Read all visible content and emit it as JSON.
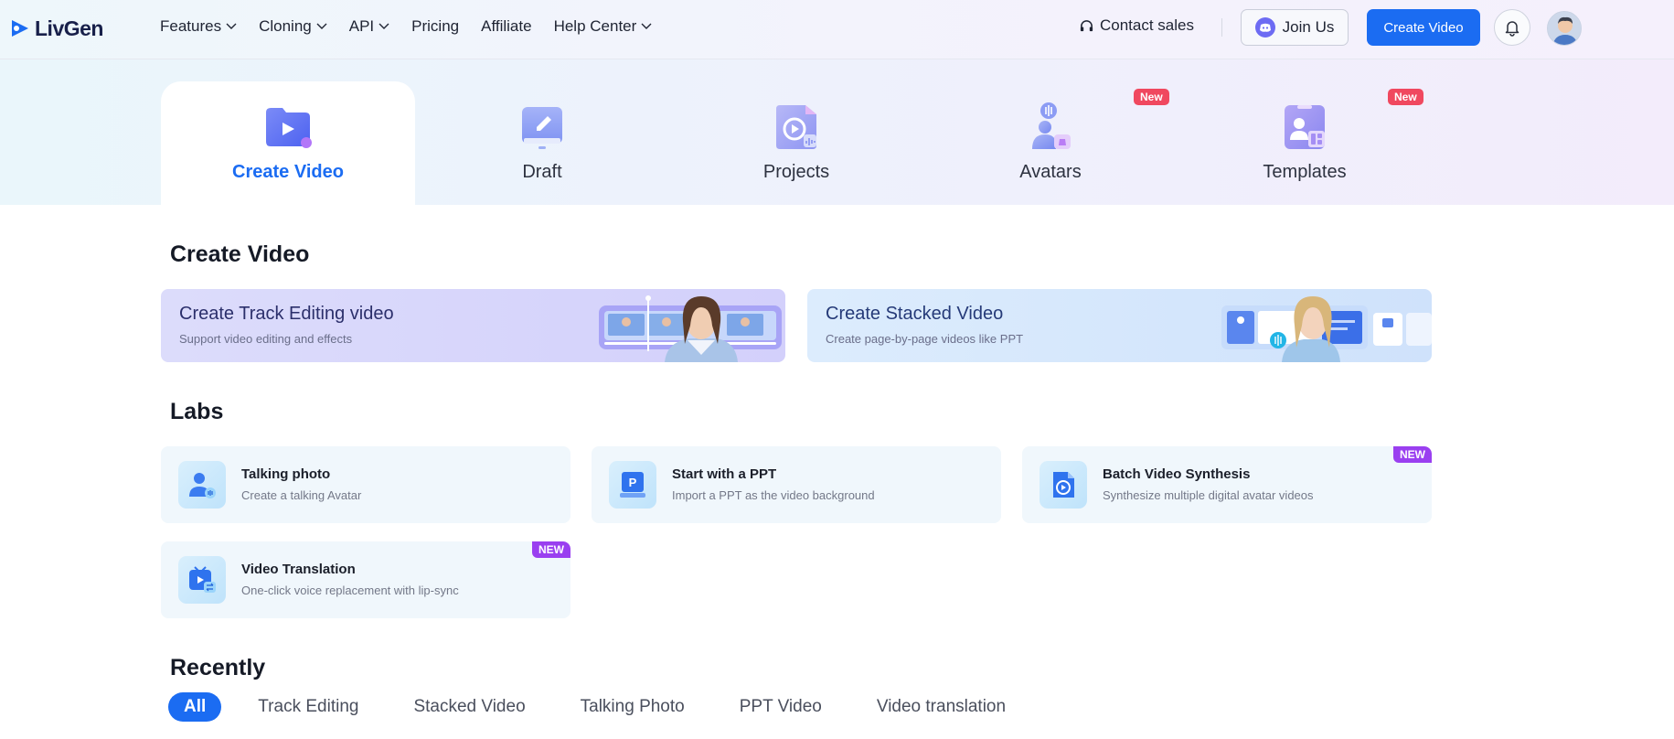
{
  "brand": {
    "name": "LivGen"
  },
  "nav": {
    "items": [
      {
        "label": "Features",
        "dropdown": true
      },
      {
        "label": "Cloning",
        "dropdown": true
      },
      {
        "label": "API",
        "dropdown": true
      },
      {
        "label": "Pricing",
        "dropdown": false
      },
      {
        "label": "Affiliate",
        "dropdown": false
      },
      {
        "label": "Help Center",
        "dropdown": true
      }
    ],
    "contact_label": "Contact sales",
    "join_label": "Join Us",
    "create_label": "Create Video"
  },
  "tabs": [
    {
      "label": "Create Video",
      "active": true,
      "badge": ""
    },
    {
      "label": "Draft",
      "active": false,
      "badge": ""
    },
    {
      "label": "Projects",
      "active": false,
      "badge": ""
    },
    {
      "label": "Avatars",
      "active": false,
      "badge": "New"
    },
    {
      "label": "Templates",
      "active": false,
      "badge": "New"
    }
  ],
  "create_section": {
    "title": "Create Video",
    "cards": [
      {
        "title": "Create Track Editing video",
        "subtitle": "Support video editing and effects"
      },
      {
        "title": "Create Stacked Video",
        "subtitle": "Create page-by-page videos like PPT"
      }
    ]
  },
  "labs": {
    "title": "Labs",
    "cards": [
      {
        "title": "Talking photo",
        "subtitle": "Create a talking Avatar",
        "badge": ""
      },
      {
        "title": "Start with a PPT",
        "subtitle": "Import a PPT as the video background",
        "badge": ""
      },
      {
        "title": "Batch Video Synthesis",
        "subtitle": "Synthesize multiple digital avatar videos",
        "badge": "NEW"
      },
      {
        "title": "Video Translation",
        "subtitle": "One-click voice replacement with lip-sync",
        "badge": "NEW"
      }
    ]
  },
  "recently": {
    "title": "Recently",
    "filters": [
      "All",
      "Track Editing",
      "Stacked Video",
      "Talking Photo",
      "PPT Video",
      "Video translation"
    ]
  },
  "colors": {
    "accent": "#1b6cf2",
    "new_badge_red": "#f0485f",
    "new_badge_purple": "#9a3ff0"
  },
  "icons": {
    "contact": "headset-icon",
    "join": "discord-icon",
    "bell": "bell-icon"
  }
}
